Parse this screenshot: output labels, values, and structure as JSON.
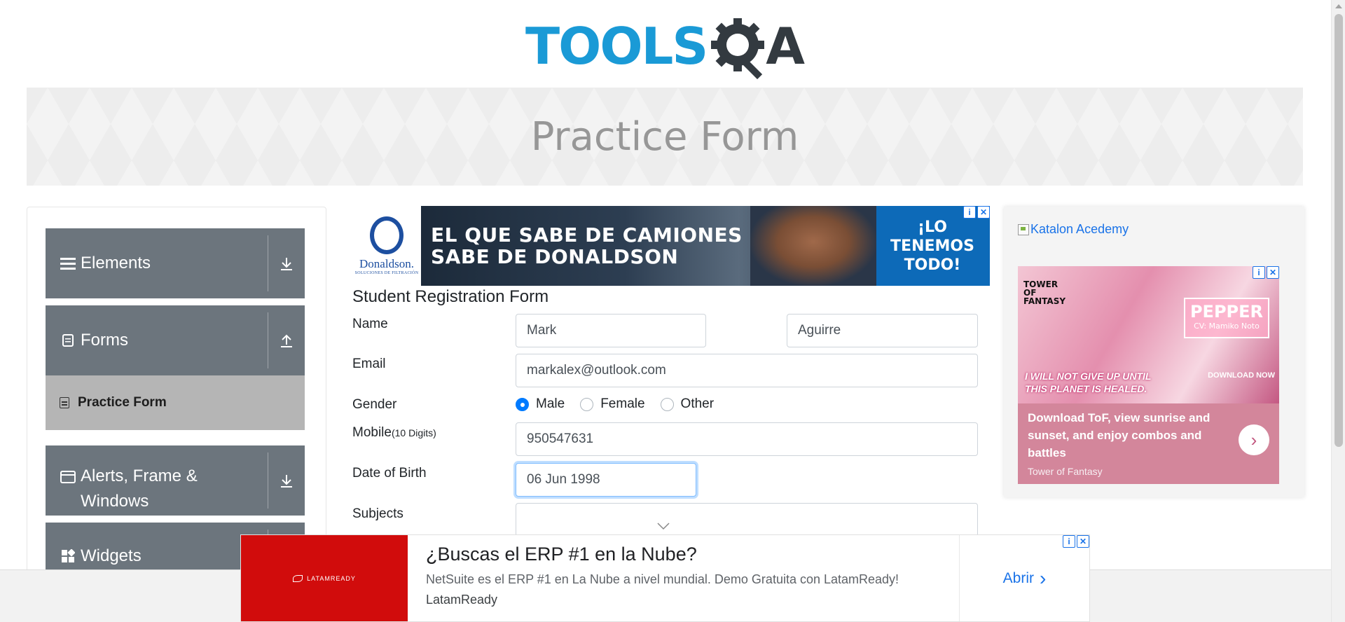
{
  "header": {
    "logo_text": "TOOLS",
    "logo_suffix": "A",
    "banner_title": "Practice Form"
  },
  "sidebar": {
    "groups": [
      {
        "label": "Elements",
        "icon": "hamburger-icon",
        "arrow": "download-arrow-icon"
      },
      {
        "label": "Forms",
        "icon": "document-icon",
        "arrow": "upload-arrow-icon"
      },
      {
        "label": "Alerts, Frame &",
        "label2": "Windows",
        "icon": "window-icon",
        "arrow": "download-arrow-icon"
      },
      {
        "label": "Widgets",
        "icon": "widgets-icon",
        "arrow": "download-arrow-icon"
      }
    ],
    "active_item": "Practice Form"
  },
  "ads": {
    "top": {
      "brand": "Donaldson.",
      "brand_sub": "SOLUCIONES DE FILTRACIÓN",
      "headline_1": "EL QUE SABE DE CAMIONES",
      "headline_2": "SABE DE DONALDSON",
      "cta_1": "¡LO",
      "cta_2": "TENEMOS",
      "cta_3": "TODO!"
    },
    "right": {
      "katalon_alt": "Katalon Acedemy",
      "tof_logo": "TOWER OF FANTASY",
      "pepper_title": "PEPPER",
      "pepper_cv": "CV: Mamiko Noto",
      "slogan_1": "I WILL NOT GIVE UP UNTIL",
      "slogan_2": "THIS PLANET IS HEALED.",
      "download_now": "DOWNLOAD NOW",
      "headline": "Download ToF, view sunrise and sunset, and enjoy combos and battles",
      "source": "Tower of Fantasy"
    },
    "bottom": {
      "brand": "LATAMREADY",
      "title": "¿Buscas el ERP #1 en la Nube?",
      "desc": "NetSuite es el ERP #1 en La Nube a nivel mundial. Demo Gratuita con LatamReady!",
      "name": "LatamReady",
      "cta": "Abrir"
    }
  },
  "form": {
    "title": "Student Registration Form",
    "name_label": "Name",
    "first_name": "Mark",
    "last_name": "Aguirre",
    "email_label": "Email",
    "email": "markalex@outlook.com",
    "gender_label": "Gender",
    "gender_options": [
      "Male",
      "Female",
      "Other"
    ],
    "gender_selected": "Male",
    "mobile_label": "Mobile",
    "mobile_hint": "(10 Digits)",
    "mobile": "950547631",
    "dob_label": "Date of Birth",
    "dob": "06 Jun 1998",
    "subjects_label": "Subjects"
  },
  "colors": {
    "logo_blue": "#1a9ad6",
    "nav_group": "#6c757d",
    "nav_active": "#b5b5b5",
    "radio_checked": "#007bff",
    "ad_red": "#d10c0c"
  }
}
